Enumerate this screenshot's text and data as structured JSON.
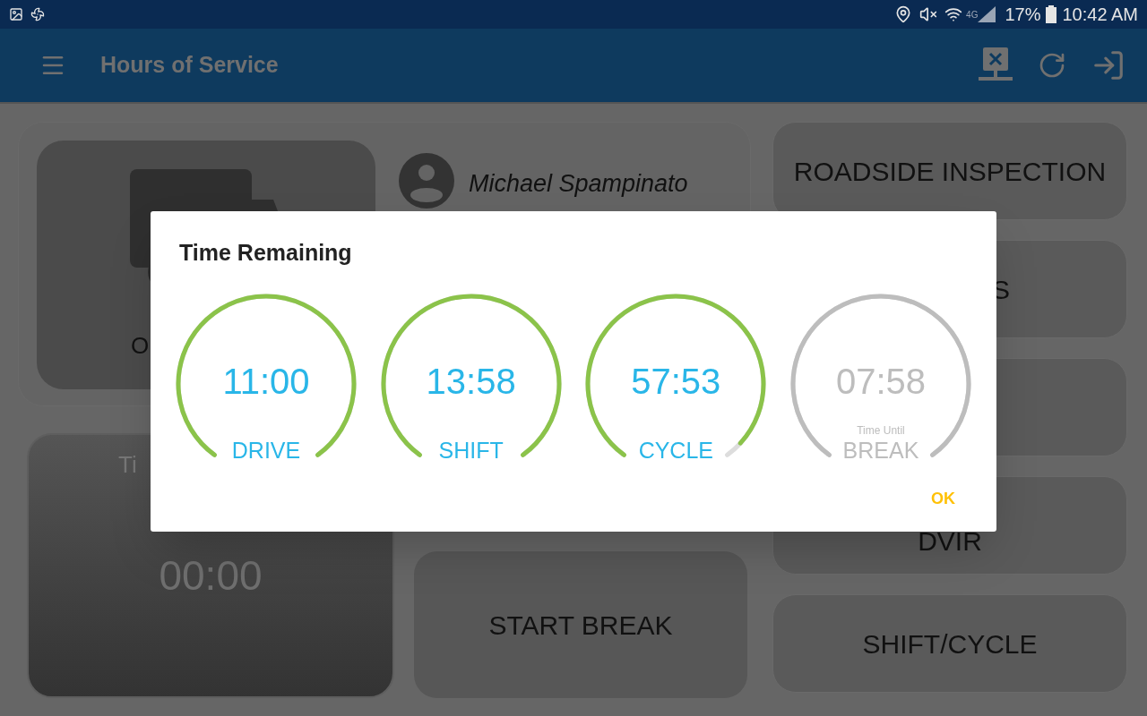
{
  "status_bar": {
    "network": "4G",
    "battery": "17%",
    "time": "10:42 AM"
  },
  "app_bar": {
    "title": "Hours of Service"
  },
  "status_tile": {
    "label": "O"
  },
  "driver": {
    "name": "Michael Spampinato"
  },
  "timer_card": {
    "label": "Ti",
    "time": "00:00"
  },
  "start_break": {
    "label": "START BREAK"
  },
  "side_buttons": [
    {
      "label": "ROADSIDE INSPECTION"
    },
    {
      "label": "S"
    },
    {
      "label": "DVIR"
    },
    {
      "label": "SHIFT/CYCLE"
    }
  ],
  "dialog": {
    "title": "Time Remaining",
    "gauges": [
      {
        "value": "11:00",
        "label": "DRIVE",
        "active": true,
        "level": 1
      },
      {
        "value": "13:58",
        "label": "SHIFT",
        "active": true,
        "level": 1
      },
      {
        "value": "57:53",
        "label": "CYCLE",
        "active": true,
        "level": 0.96
      },
      {
        "value": "07:58",
        "caption": "Time Until",
        "label": "BREAK",
        "active": false,
        "level": 1
      }
    ],
    "ok": "OK"
  }
}
